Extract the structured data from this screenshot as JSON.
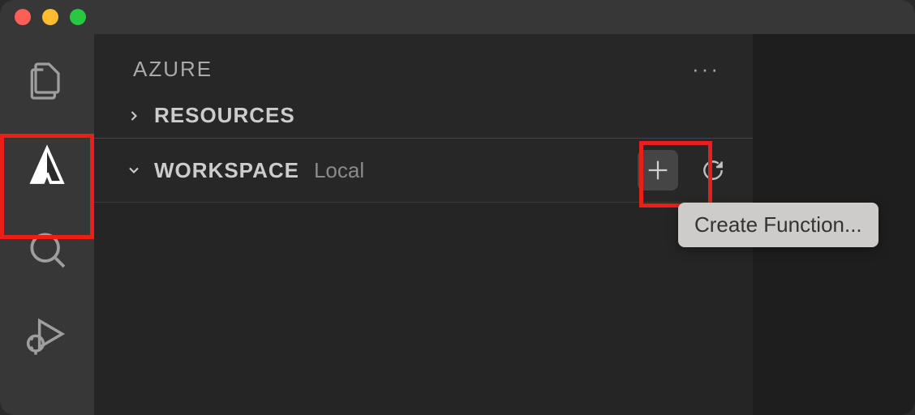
{
  "panel": {
    "title": "AZURE"
  },
  "sections": {
    "resources": {
      "label": "RESOURCES",
      "expanded": false
    },
    "workspace": {
      "label": "WORKSPACE",
      "description": "Local",
      "expanded": true
    }
  },
  "tooltip": {
    "createFunction": "Create Function..."
  },
  "activityBar": [
    "explorer",
    "azure",
    "search",
    "run-debug"
  ]
}
